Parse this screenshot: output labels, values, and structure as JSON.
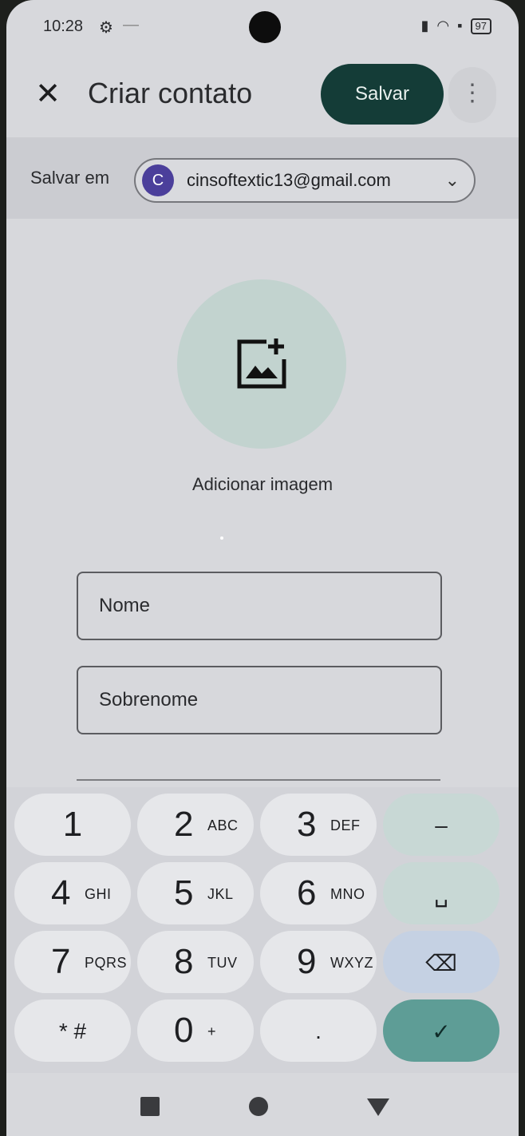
{
  "status_bar": {
    "time": "10:28",
    "battery": "97"
  },
  "app_bar": {
    "close_icon": "close-icon",
    "title": "Criar contato",
    "save_label": "Salvar",
    "more_icon": "more-vert-icon"
  },
  "save_to": {
    "label": "Salvar em",
    "avatar_letter": "C",
    "email": "cinsoftextic13@gmail.com"
  },
  "photo": {
    "icon": "add-photo-icon",
    "label": "Adicionar imagem"
  },
  "fields": {
    "first_name_placeholder": "Nome",
    "last_name_placeholder": "Sobrenome"
  },
  "keypad": {
    "keys": [
      {
        "digit": "1",
        "letters": ""
      },
      {
        "digit": "2",
        "letters": "ABC"
      },
      {
        "digit": "3",
        "letters": "DEF"
      },
      {
        "digit": "–",
        "letters": ""
      },
      {
        "digit": "4",
        "letters": "GHI"
      },
      {
        "digit": "5",
        "letters": "JKL"
      },
      {
        "digit": "6",
        "letters": "MNO"
      },
      {
        "digit": "␣",
        "letters": ""
      },
      {
        "digit": "7",
        "letters": "PQRS"
      },
      {
        "digit": "8",
        "letters": "TUV"
      },
      {
        "digit": "9",
        "letters": "WXYZ"
      },
      {
        "digit": "⌫",
        "letters": ""
      },
      {
        "digit": "* #",
        "letters": ""
      },
      {
        "digit": "0",
        "letters": "+"
      },
      {
        "digit": ".",
        "letters": ""
      },
      {
        "digit": "✓",
        "letters": ""
      }
    ]
  },
  "colors": {
    "save_button": "#143c37",
    "confirm_key": "#5e9d96",
    "avatar": "#4b3f9b"
  }
}
